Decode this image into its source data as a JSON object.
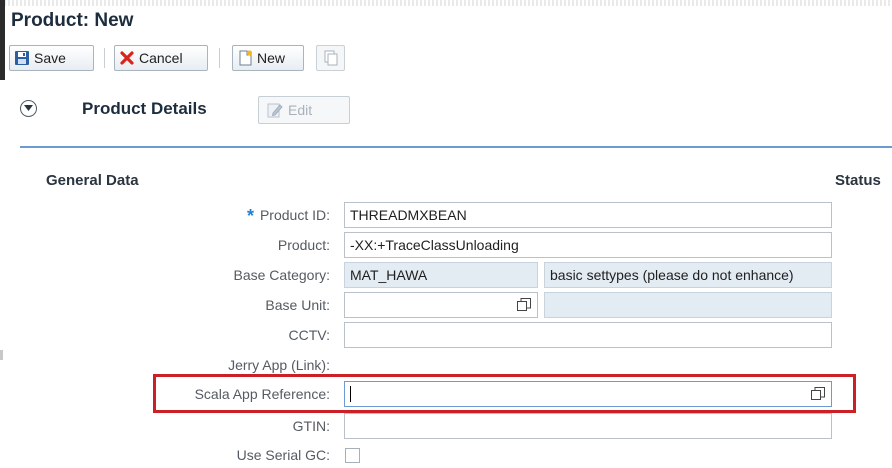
{
  "header": {
    "title": "Product: New"
  },
  "toolbar": {
    "save_label": "Save",
    "cancel_label": "Cancel",
    "new_label": "New"
  },
  "section": {
    "title": "Product Details",
    "edit_label": "Edit"
  },
  "general_data": {
    "title": "General Data",
    "status_title": "Status",
    "fields": {
      "product_id": {
        "label": "Product ID:",
        "value": "THREADMXBEAN",
        "required_marker": "*"
      },
      "product": {
        "label": "Product:",
        "value": "-XX:+TraceClassUnloading"
      },
      "base_category": {
        "label": "Base Category:",
        "value": "MAT_HAWA",
        "description": "basic settypes (please do not enhance)"
      },
      "base_unit": {
        "label": "Base Unit:",
        "value": ""
      },
      "cctv": {
        "label": "CCTV:",
        "value": ""
      },
      "jerry_app": {
        "label": "Jerry App (Link):"
      },
      "scala_app_reference": {
        "label": "Scala App Reference:",
        "value": ""
      },
      "gtin": {
        "label": "GTIN:",
        "value": ""
      },
      "use_serial_gc": {
        "label": "Use Serial GC:",
        "checked": false
      }
    }
  },
  "colors": {
    "accent": "#6b9bd1",
    "required": "#1e7fd7",
    "highlight": "#cc2027",
    "readonly_bg": "#e3ebf3"
  },
  "icons": {
    "save": "floppy-disk-icon",
    "cancel": "red-x-icon",
    "new": "new-document-icon",
    "copy": "copy-document-icon",
    "edit": "pencil-icon",
    "collapse": "chevron-down-icon",
    "value_help": "value-help-icon"
  }
}
